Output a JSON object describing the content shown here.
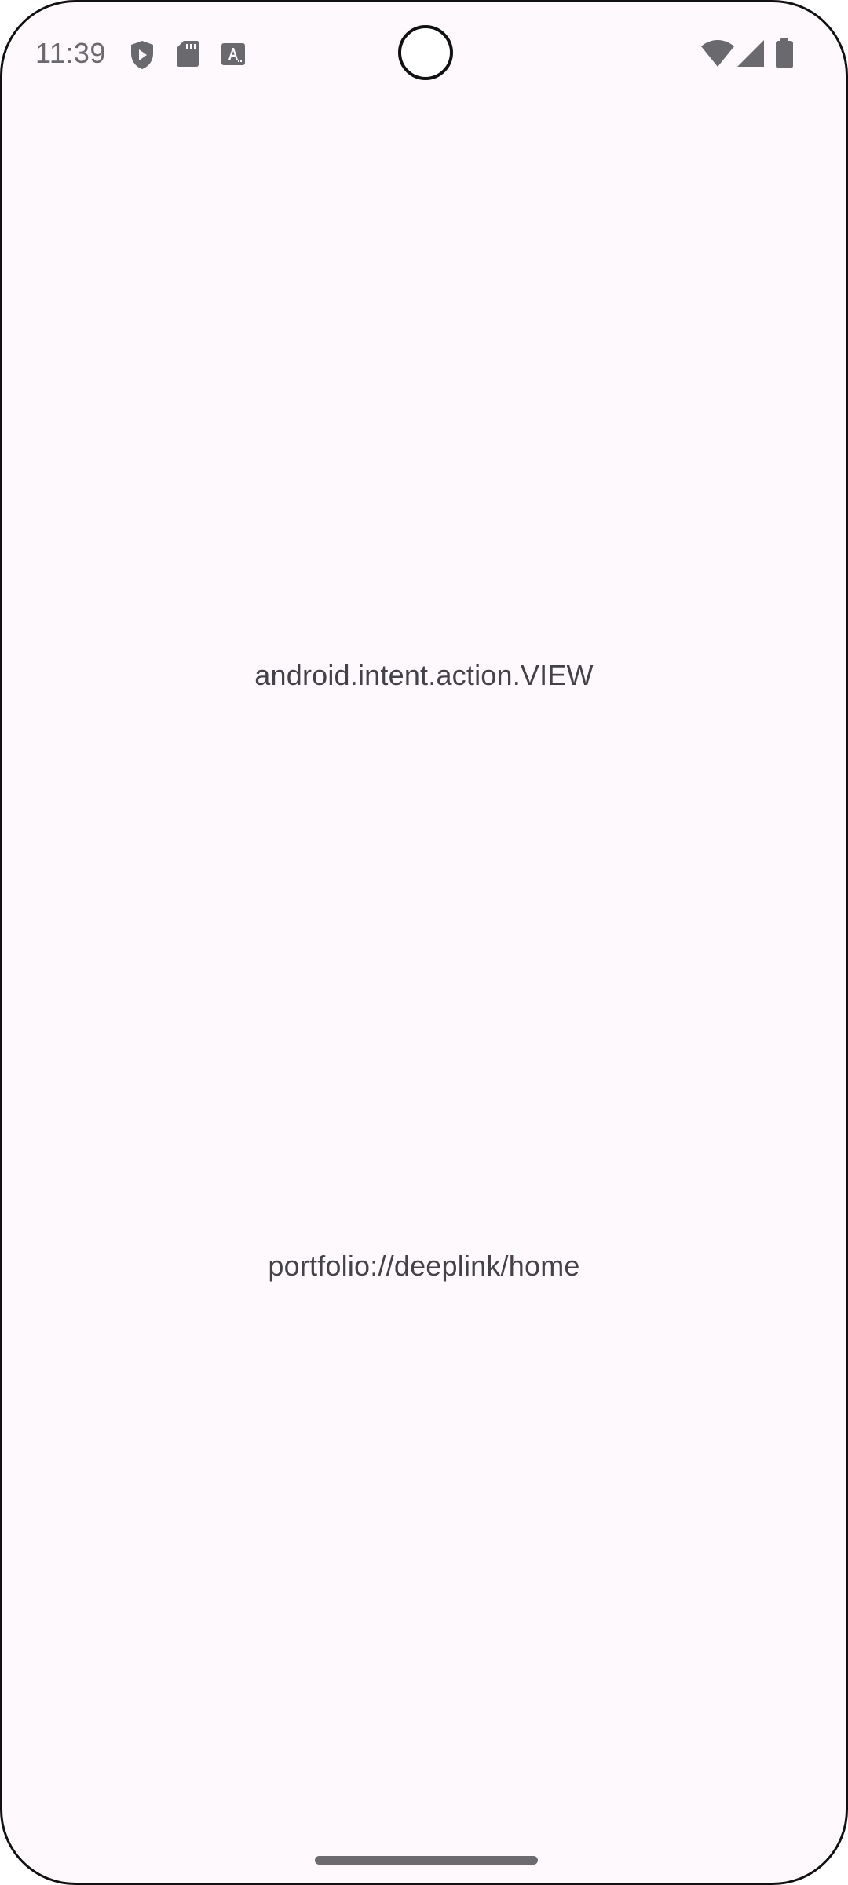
{
  "status_bar": {
    "time": "11:39",
    "left_icons": [
      "play-protect-shield-icon",
      "sd-card-icon",
      "text-recognition-icon"
    ],
    "right_icons": [
      "wifi-icon",
      "cell-signal-icon",
      "battery-icon"
    ]
  },
  "main": {
    "intent_action": "android.intent.action.VIEW",
    "deeplink_uri": "portfolio://deeplink/home"
  },
  "colors": {
    "background": "#fef9fc",
    "text": "#434248",
    "status_icons": "#6a6a6e"
  }
}
